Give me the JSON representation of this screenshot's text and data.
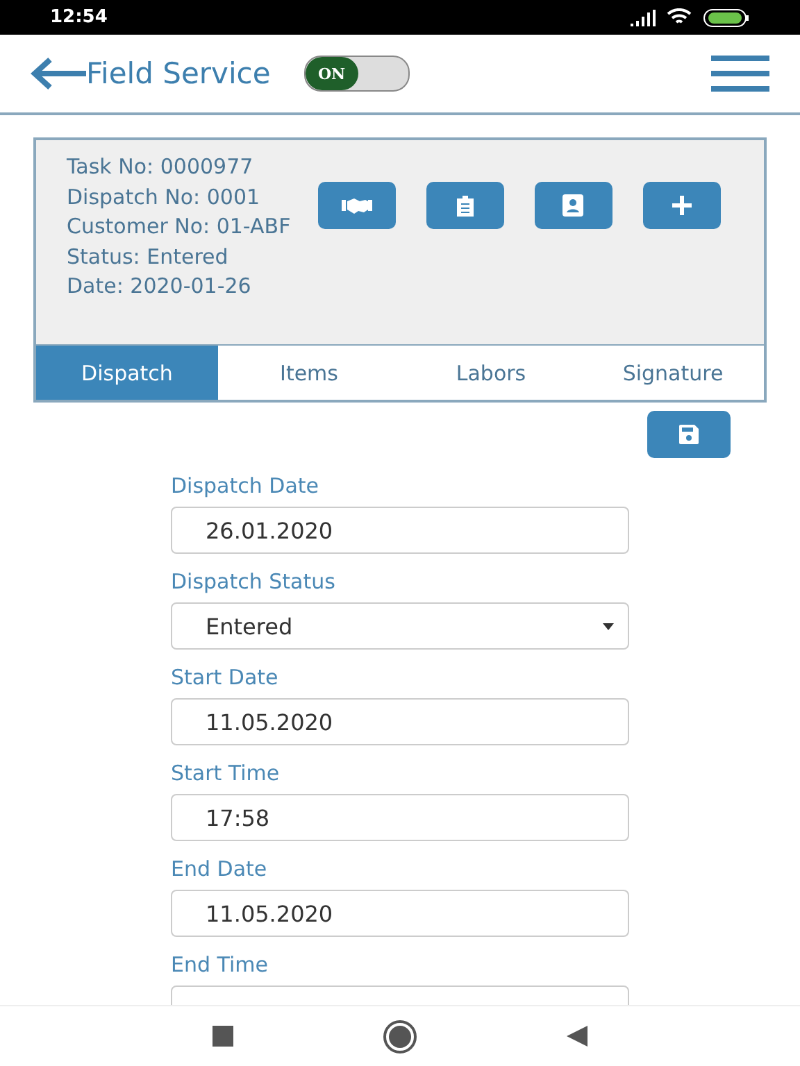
{
  "status_bar": {
    "time": "12:54"
  },
  "header": {
    "title": "Field Service",
    "toggle": {
      "label": "ON",
      "on": true
    }
  },
  "task": {
    "lines": [
      "Task No: 0000977",
      "Dispatch No: 0001",
      "Customer No: 01-ABF",
      "Status: Entered",
      "Date: 2020-01-26"
    ],
    "actions": [
      {
        "kind": "handshake"
      },
      {
        "kind": "clipboard"
      },
      {
        "kind": "contact"
      },
      {
        "kind": "add"
      }
    ]
  },
  "tabs": [
    {
      "label": "Dispatch",
      "selected": true
    },
    {
      "label": "Items",
      "selected": false
    },
    {
      "label": "Labors",
      "selected": false
    },
    {
      "label": "Signature",
      "selected": false
    }
  ],
  "form": [
    {
      "label": "Dispatch Date",
      "kind": "text",
      "value": "26.01.2020"
    },
    {
      "label": "Dispatch Status",
      "kind": "select",
      "value": "Entered"
    },
    {
      "label": "Start Date",
      "kind": "text",
      "value": "11.05.2020"
    },
    {
      "label": "Start Time",
      "kind": "text",
      "value": "17:58"
    },
    {
      "label": "End Date",
      "kind": "text",
      "value": "11.05.2020"
    },
    {
      "label": "End Time",
      "kind": "text"
    }
  ]
}
